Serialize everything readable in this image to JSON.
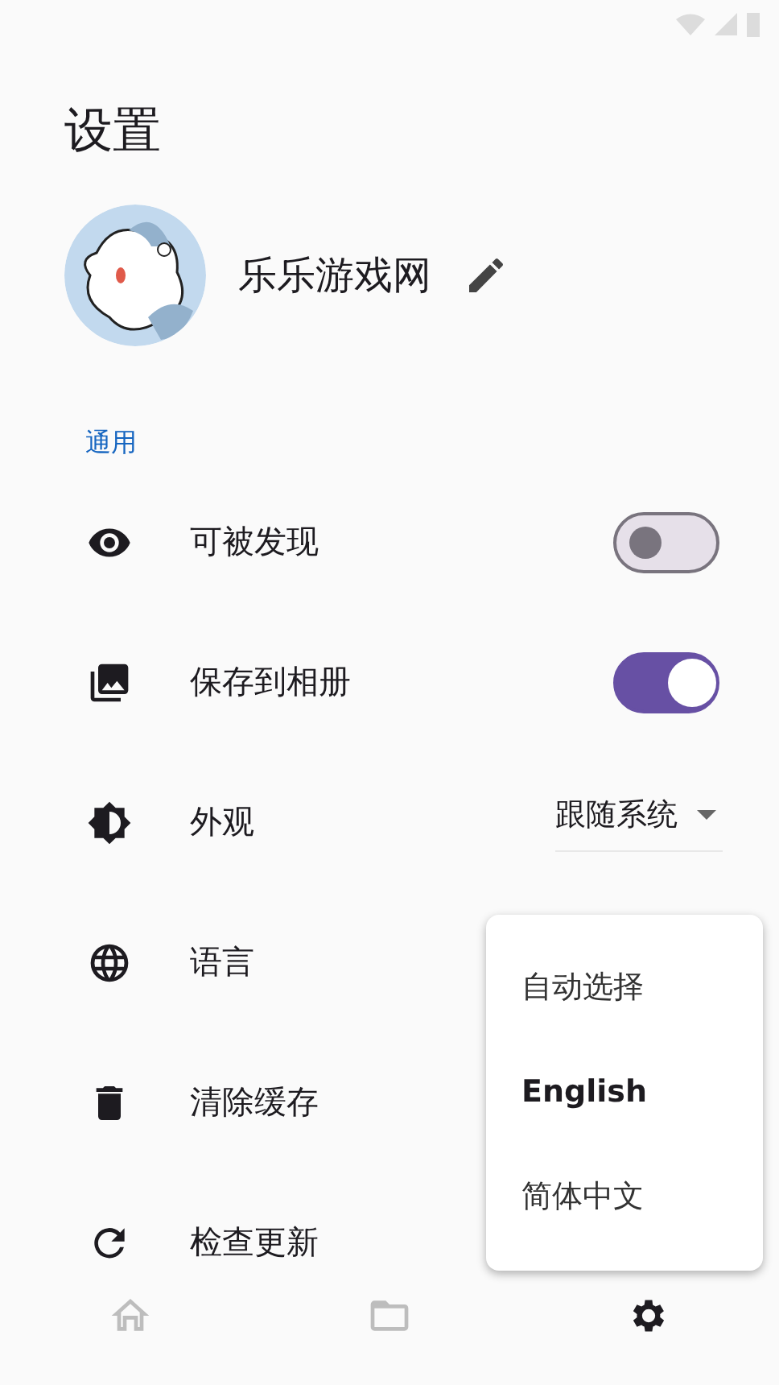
{
  "title": "设置",
  "profile": {
    "name": "乐乐游戏网"
  },
  "section": "通用",
  "settings": [
    {
      "kind": "switch",
      "label": "可被发现",
      "on": false
    },
    {
      "kind": "switch",
      "label": "保存到相册",
      "on": true
    },
    {
      "kind": "dropdown",
      "label": "外观",
      "value": "跟随系统"
    },
    {
      "kind": "plain",
      "label": "语言"
    },
    {
      "kind": "plain",
      "label": "清除缓存"
    },
    {
      "kind": "plain",
      "label": "检查更新"
    }
  ],
  "menu": [
    {
      "label": "自动选择",
      "selected": false
    },
    {
      "label": "English",
      "selected": true
    },
    {
      "label": "简体中文",
      "selected": false
    }
  ],
  "nav": [
    {
      "selected": false
    },
    {
      "selected": false
    },
    {
      "selected": true
    }
  ]
}
